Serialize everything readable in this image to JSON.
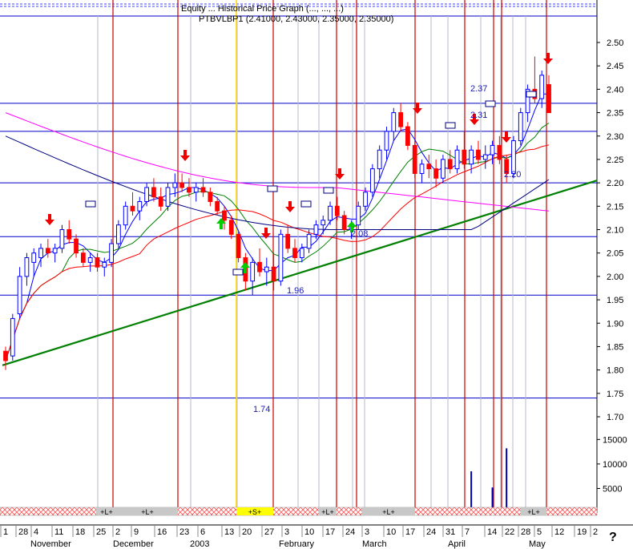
{
  "header": {
    "line1": "Equity ... Historical Price Graph (..., ..., ...)",
    "line2": "PTBVLBP1 (2.41000, 2.43000, 2.35000, 2.35000)"
  },
  "help_glyph": "?",
  "colors": {
    "candle_up": "#0000ff",
    "candle_down": "#ff0000",
    "ma_short": "#0000ff",
    "ma_mid": "#008000",
    "ma_long": "#ff0000",
    "ma_200": "#ff00ff",
    "ma_dark": "#000080",
    "trendline": "#008000",
    "hline": "#0000c8",
    "vline_red": "#cc0000",
    "vline_yellow": "#ffd800",
    "volume": "#0000aa",
    "arrow_sell": "#ee0000",
    "arrow_buy": "#00cc00"
  },
  "chart_data": {
    "type": "candlestick",
    "price_axis": {
      "ylim": [
        1.7,
        2.52
      ],
      "ticks": [
        "2.50",
        "2.45",
        "2.40",
        "2.35",
        "2.30",
        "2.25",
        "2.20",
        "2.15",
        "2.10",
        "2.05",
        "2.00",
        "1.95",
        "1.90",
        "1.85",
        "1.80",
        "1.75",
        "1.70"
      ]
    },
    "volume_axis": {
      "ticks": [
        "15000",
        "10000",
        "5000"
      ],
      "ylim": [
        0,
        18000
      ]
    },
    "x_axis": {
      "date_ticks": [
        "1",
        "28",
        "4",
        "11",
        "18",
        "25",
        "2",
        "9",
        "16",
        "23",
        "6",
        "13",
        "20",
        "27",
        "3",
        "10",
        "17",
        "24",
        "3",
        "10",
        "17",
        "24",
        "31",
        "7",
        "14",
        "22",
        "28",
        "5",
        "12",
        "19",
        "2"
      ],
      "month_labels": [
        "November",
        "December",
        "2003",
        "February",
        "March",
        "April",
        "May"
      ]
    },
    "levels": [
      "2.37",
      "2.31",
      "2.20",
      "2.08",
      "1.96",
      "1.74"
    ],
    "horizontal_lines": [
      2.37,
      2.31,
      2.2,
      2.085,
      1.96,
      1.74
    ],
    "trendline": {
      "from": [
        "2002-10-28",
        1.81
      ],
      "to": [
        "2003-05-19",
        2.2
      ]
    },
    "bands": [
      "+L+",
      "+L+",
      "+S+",
      "+L+",
      "+L+",
      "+L+"
    ],
    "candles": [
      [
        1.84,
        1.85,
        1.8,
        1.82
      ],
      [
        1.83,
        1.92,
        1.82,
        1.91
      ],
      [
        1.92,
        2.02,
        1.91,
        2.0
      ],
      [
        2.0,
        2.05,
        1.98,
        2.04
      ],
      [
        2.03,
        2.06,
        2.0,
        2.05
      ],
      [
        2.04,
        2.07,
        2.02,
        2.06
      ],
      [
        2.06,
        2.08,
        2.04,
        2.05
      ],
      [
        2.05,
        2.07,
        2.03,
        2.06
      ],
      [
        2.06,
        2.11,
        2.05,
        2.1
      ],
      [
        2.1,
        2.12,
        2.07,
        2.08
      ],
      [
        2.08,
        2.09,
        2.04,
        2.05
      ],
      [
        2.05,
        2.06,
        2.02,
        2.03
      ],
      [
        2.03,
        2.05,
        2.01,
        2.04
      ],
      [
        2.04,
        2.05,
        2.01,
        2.02
      ],
      [
        2.02,
        2.04,
        2.0,
        2.03
      ],
      [
        2.03,
        2.08,
        2.02,
        2.07
      ],
      [
        2.07,
        2.12,
        2.06,
        2.11
      ],
      [
        2.11,
        2.16,
        2.1,
        2.15
      ],
      [
        2.15,
        2.18,
        2.13,
        2.14
      ],
      [
        2.14,
        2.17,
        2.12,
        2.16
      ],
      [
        2.16,
        2.2,
        2.15,
        2.19
      ],
      [
        2.19,
        2.21,
        2.16,
        2.17
      ],
      [
        2.17,
        2.19,
        2.14,
        2.15
      ],
      [
        2.15,
        2.2,
        2.14,
        2.19
      ],
      [
        2.19,
        2.22,
        2.17,
        2.2
      ],
      [
        2.2,
        2.22,
        2.18,
        2.19
      ],
      [
        2.19,
        2.21,
        2.17,
        2.18
      ],
      [
        2.18,
        2.2,
        2.16,
        2.19
      ],
      [
        2.19,
        2.21,
        2.17,
        2.18
      ],
      [
        2.18,
        2.19,
        2.15,
        2.16
      ],
      [
        2.16,
        2.17,
        2.13,
        2.14
      ],
      [
        2.14,
        2.15,
        2.1,
        2.12
      ],
      [
        2.12,
        2.13,
        2.08,
        2.09
      ],
      [
        2.09,
        2.1,
        2.03,
        2.04
      ],
      [
        2.04,
        2.05,
        1.97,
        1.99
      ],
      [
        1.99,
        2.04,
        1.96,
        2.03
      ],
      [
        2.03,
        2.06,
        2.0,
        2.01
      ],
      [
        2.01,
        2.04,
        1.98,
        2.02
      ],
      [
        2.02,
        2.05,
        1.97,
        1.99
      ],
      [
        1.99,
        2.1,
        1.98,
        2.09
      ],
      [
        2.09,
        2.11,
        2.05,
        2.06
      ],
      [
        2.06,
        2.08,
        2.03,
        2.04
      ],
      [
        2.04,
        2.07,
        2.03,
        2.06
      ],
      [
        2.06,
        2.1,
        2.05,
        2.09
      ],
      [
        2.09,
        2.12,
        2.08,
        2.11
      ],
      [
        2.11,
        2.13,
        2.09,
        2.12
      ],
      [
        2.12,
        2.16,
        2.11,
        2.15
      ],
      [
        2.15,
        2.17,
        2.12,
        2.13
      ],
      [
        2.13,
        2.14,
        2.09,
        2.1
      ],
      [
        2.1,
        2.12,
        2.08,
        2.11
      ],
      [
        2.11,
        2.16,
        2.1,
        2.15
      ],
      [
        2.15,
        2.19,
        2.14,
        2.18
      ],
      [
        2.18,
        2.24,
        2.17,
        2.23
      ],
      [
        2.23,
        2.28,
        2.21,
        2.27
      ],
      [
        2.27,
        2.32,
        2.25,
        2.31
      ],
      [
        2.31,
        2.36,
        2.29,
        2.35
      ],
      [
        2.35,
        2.37,
        2.31,
        2.32
      ],
      [
        2.32,
        2.33,
        2.27,
        2.28
      ],
      [
        2.28,
        2.29,
        2.21,
        2.22
      ],
      [
        2.22,
        2.25,
        2.2,
        2.24
      ],
      [
        2.24,
        2.26,
        2.21,
        2.23
      ],
      [
        2.23,
        2.25,
        2.19,
        2.21
      ],
      [
        2.21,
        2.26,
        2.2,
        2.25
      ],
      [
        2.25,
        2.27,
        2.22,
        2.23
      ],
      [
        2.23,
        2.28,
        2.22,
        2.27
      ],
      [
        2.27,
        2.31,
        2.23,
        2.24
      ],
      [
        2.24,
        2.28,
        2.22,
        2.27
      ],
      [
        2.27,
        2.29,
        2.24,
        2.25
      ],
      [
        2.25,
        2.28,
        2.23,
        2.26
      ],
      [
        2.26,
        2.29,
        2.24,
        2.28
      ],
      [
        2.28,
        2.3,
        2.24,
        2.25
      ],
      [
        2.25,
        2.26,
        2.2,
        2.22
      ],
      [
        2.22,
        2.3,
        2.21,
        2.29
      ],
      [
        2.29,
        2.36,
        2.28,
        2.35
      ],
      [
        2.35,
        2.41,
        2.33,
        2.4
      ],
      [
        2.4,
        2.47,
        2.37,
        2.38
      ],
      [
        2.38,
        2.44,
        2.36,
        2.43
      ],
      [
        2.41,
        2.43,
        2.35,
        2.35
      ]
    ],
    "volume": [
      900,
      600,
      300,
      400,
      300,
      200,
      500,
      300,
      400,
      200,
      300,
      200,
      300,
      600,
      400,
      300,
      200,
      400,
      300,
      500,
      300,
      200,
      400,
      300,
      600,
      500,
      400,
      300,
      200,
      400,
      500,
      300,
      200,
      400,
      500,
      300,
      200,
      400,
      300,
      200,
      500,
      400,
      300,
      200,
      400,
      300,
      200,
      600,
      400,
      300,
      200,
      400,
      300,
      500,
      300,
      400,
      200,
      300,
      500,
      400,
      300,
      200,
      400,
      300,
      600,
      700,
      8500,
      400,
      300,
      5200,
      600,
      13200,
      900,
      500,
      600,
      400,
      700,
      500
    ]
  }
}
